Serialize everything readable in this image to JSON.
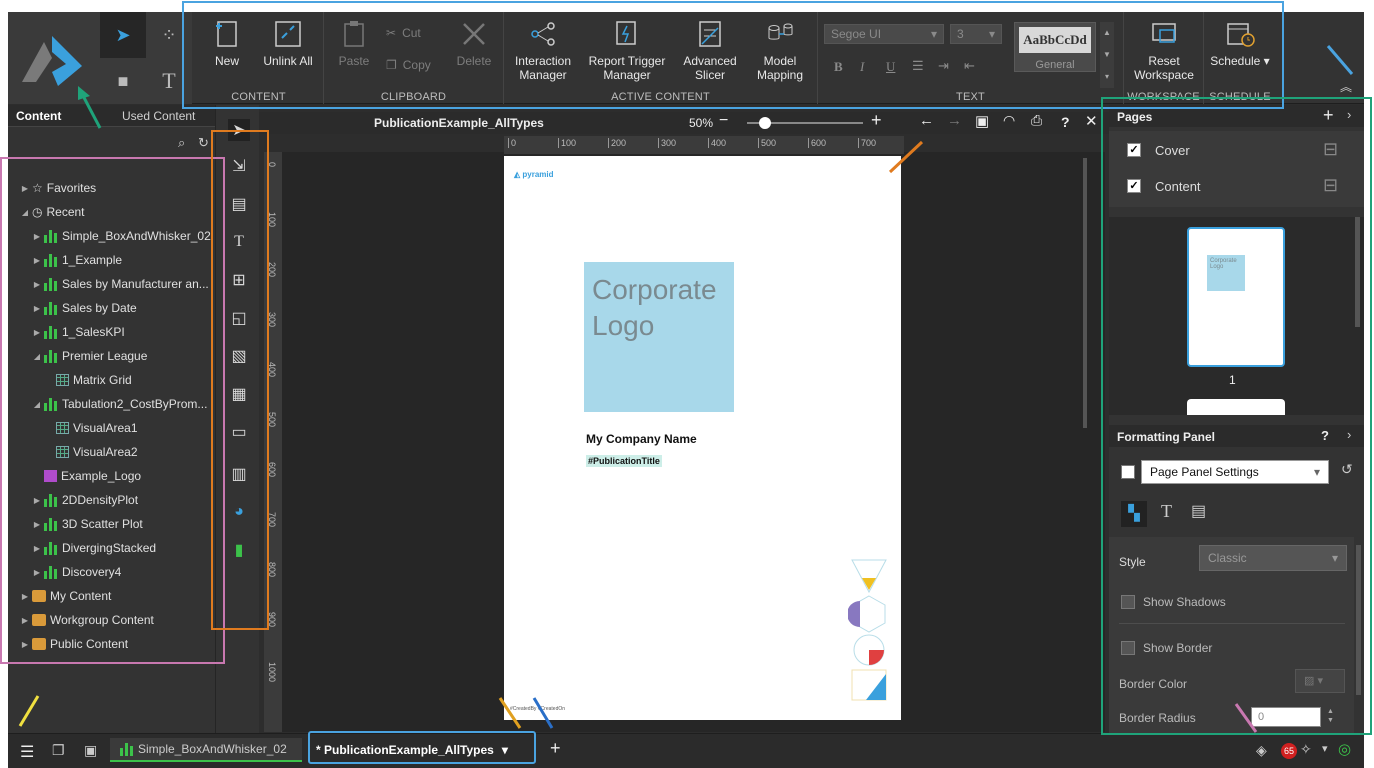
{
  "mode_tabs": [
    "send-icon",
    "apps-icon",
    "page-icon",
    "text-icon"
  ],
  "ribbon": {
    "content": {
      "title": "CONTENT",
      "new": "New",
      "unlink_all": "Unlink All"
    },
    "clipboard": {
      "title": "CLIPBOARD",
      "paste": "Paste",
      "cut": "Cut",
      "copy": "Copy",
      "delete": "Delete"
    },
    "active_content": {
      "title": "ACTIVE CONTENT",
      "interaction_manager": "Interaction Manager",
      "report_trigger_manager": "Report Trigger Manager",
      "advanced_slicer": "Advanced Slicer",
      "model_mapping": "Model Mapping"
    },
    "text": {
      "title": "TEXT",
      "font": "Segoe UI",
      "size": "3",
      "style_preview": "AaBbCcDd",
      "style_name": "General"
    },
    "workspace": {
      "title": "WORKSPACE",
      "reset": "Reset Workspace"
    },
    "schedule": {
      "title": "SCHEDULE",
      "schedule": "Schedule ▾"
    }
  },
  "left_panel": {
    "tabs": [
      "Content",
      "Used Content"
    ],
    "tree": [
      {
        "label": "Favorites",
        "icon": "star-icon",
        "indent": 0,
        "expand": "collapsed"
      },
      {
        "label": "Recent",
        "icon": "clock-icon",
        "indent": 0,
        "expand": "expanded"
      },
      {
        "label": "Simple_BoxAndWhisker_02",
        "icon": "bar-chart-icon",
        "indent": 1,
        "expand": "collapsed"
      },
      {
        "label": "1_Example",
        "icon": "bar-chart-icon",
        "indent": 1,
        "expand": "collapsed"
      },
      {
        "label": "Sales by Manufacturer an...",
        "icon": "bar-chart-icon",
        "indent": 1,
        "expand": "collapsed"
      },
      {
        "label": "Sales by Date",
        "icon": "bar-chart-icon",
        "indent": 1,
        "expand": "collapsed"
      },
      {
        "label": "1_SalesKPI",
        "icon": "bar-chart-icon",
        "indent": 1,
        "expand": "collapsed"
      },
      {
        "label": "Premier League",
        "icon": "bar-chart-icon",
        "indent": 1,
        "expand": "expanded"
      },
      {
        "label": "Matrix Grid",
        "icon": "grid-icon",
        "indent": 2,
        "expand": "none"
      },
      {
        "label": "Tabulation2_CostByProm...",
        "icon": "bar-chart-icon",
        "indent": 1,
        "expand": "expanded"
      },
      {
        "label": "VisualArea1",
        "icon": "grid-icon",
        "indent": 2,
        "expand": "none"
      },
      {
        "label": "VisualArea2",
        "icon": "grid-icon",
        "indent": 2,
        "expand": "none"
      },
      {
        "label": "Example_Logo",
        "icon": "image-icon",
        "indent": 1,
        "expand": "none"
      },
      {
        "label": "2DDensityPlot",
        "icon": "bar-chart-icon",
        "indent": 1,
        "expand": "collapsed"
      },
      {
        "label": "3D Scatter Plot",
        "icon": "bar-chart-icon",
        "indent": 1,
        "expand": "collapsed"
      },
      {
        "label": "DivergingStacked",
        "icon": "bar-chart-icon",
        "indent": 1,
        "expand": "collapsed"
      },
      {
        "label": "Discovery4",
        "icon": "bar-chart-icon",
        "indent": 1,
        "expand": "collapsed"
      },
      {
        "label": "My Content",
        "icon": "folder-icon",
        "indent": 0,
        "expand": "collapsed"
      },
      {
        "label": "Workgroup Content",
        "icon": "folder-icon",
        "indent": 0,
        "expand": "collapsed"
      },
      {
        "label": "Public Content",
        "icon": "folder-icon",
        "indent": 0,
        "expand": "collapsed"
      }
    ]
  },
  "doc_bar": {
    "title": "PublicationExample_AllTypes",
    "zoom": "50%",
    "zoom_level": 0.1
  },
  "ruler": {
    "top": [
      "0",
      "100",
      "200",
      "300",
      "400",
      "500",
      "600",
      "700"
    ],
    "left": [
      "0",
      "100",
      "200",
      "300",
      "400",
      "500",
      "600",
      "700",
      "800",
      "900",
      "1000"
    ]
  },
  "page": {
    "brand": "pyramid",
    "logo_text": "Corporate Logo",
    "company": "My Company Name",
    "pub_title": "#PublicationTitle",
    "footer": "#CreatedBy #CreatedOn"
  },
  "right_panel": {
    "pages_title": "Pages",
    "pages": [
      {
        "label": "Cover",
        "checked": true
      },
      {
        "label": "Content",
        "checked": true
      }
    ],
    "thumb_number": "1",
    "thumb_logo": "Corporate Logo",
    "formatting_title": "Formatting Panel",
    "settings_select": "Page Panel Settings",
    "style_label": "Style",
    "style_value": "Classic",
    "show_shadows": "Show Shadows",
    "show_border": "Show Border",
    "border_color": "Border Color",
    "border_radius": "Border Radius",
    "border_radius_value": "0",
    "help": "?"
  },
  "status": {
    "tabs": [
      {
        "label": "Simple_BoxAndWhisker_02"
      },
      {
        "label": "* PublicationExample_AllTypes"
      }
    ],
    "notifications": "65"
  },
  "colors": {
    "accent": "#3aa0dd",
    "green_bar": "#3cc24a",
    "logo_box": "#a8d8ea",
    "highlight_blue": "#4aa3e0",
    "highlight_green": "#1fa37a",
    "highlight_pink": "#c878b0",
    "highlight_orange": "#e07b1f"
  }
}
